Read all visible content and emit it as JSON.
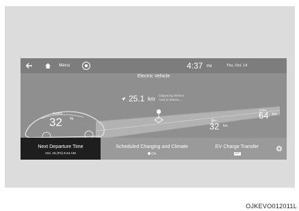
{
  "header": {
    "menu_label": "Menu",
    "time": "4:37",
    "ampm": "PM",
    "date": "Thu, Oct. 14"
  },
  "main": {
    "title": "Electric Vehicle",
    "battery_label": "Battery",
    "battery_value": "32",
    "battery_unit": "%",
    "destination_distance": "25.1",
    "destination_unit": "km",
    "destination_name_line1": "Gapyeong Service",
    "destination_name_line2": "Area to Munsa...",
    "range_min_label": "Min",
    "range_min_value": "32",
    "range_max_label": "Max",
    "range_max_value": "64",
    "range_unit": "km"
  },
  "bottom_tabs": {
    "next_departure_label": "Next Departure Time",
    "next_departure_value": "Oct. 15 (Fri) 6:44 AM",
    "scheduled_label": "Scheduled Charging and Climate",
    "scheduled_status": "ON",
    "ev_transfer_label": "EV Charge Transfer",
    "ev_transfer_status": "OFF"
  },
  "caption": "OJKEVO012011L",
  "icons": {
    "back": "back-arrow-icon",
    "home": "home-icon",
    "settings": "gear-icon"
  },
  "colors": {
    "screen_bg": "#8f8f8f",
    "topbar_bg": "#7d7d7d",
    "selected_tab_bg": "#1e1e1e"
  }
}
